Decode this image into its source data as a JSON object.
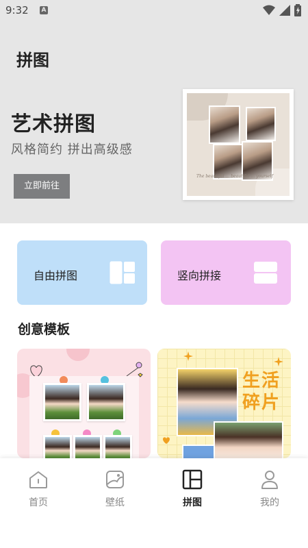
{
  "status_bar": {
    "time": "9:32",
    "badge": "A"
  },
  "header": {
    "title": "拼图"
  },
  "hero": {
    "title": "艺术拼图",
    "subtitle": "风格简约 拼出高级感",
    "button_label": "立即前往",
    "card_script": "The beautiful … beautiful … yourself"
  },
  "features": [
    {
      "label": "自由拼图",
      "color": "#bfdff9"
    },
    {
      "label": "竖向拼接",
      "color": "#f3c4f3"
    }
  ],
  "templates_section": {
    "title": "创意模板"
  },
  "templates": [
    {
      "name": "cute-pin-collage"
    },
    {
      "name": "life-fragments",
      "text_line1": "生活",
      "text_line2": "碎片"
    }
  ],
  "nav": {
    "items": [
      {
        "label": "首页",
        "icon": "home-icon",
        "active": false
      },
      {
        "label": "壁纸",
        "icon": "wallpaper-icon",
        "active": false
      },
      {
        "label": "拼图",
        "icon": "collage-icon",
        "active": true
      },
      {
        "label": "我的",
        "icon": "profile-icon",
        "active": false
      }
    ]
  },
  "colors": {
    "accent_blue": "#bfdff9",
    "accent_pink": "#f3c4f3",
    "hero_bg": "#e6e6e6",
    "template_text": "#f0a020"
  }
}
